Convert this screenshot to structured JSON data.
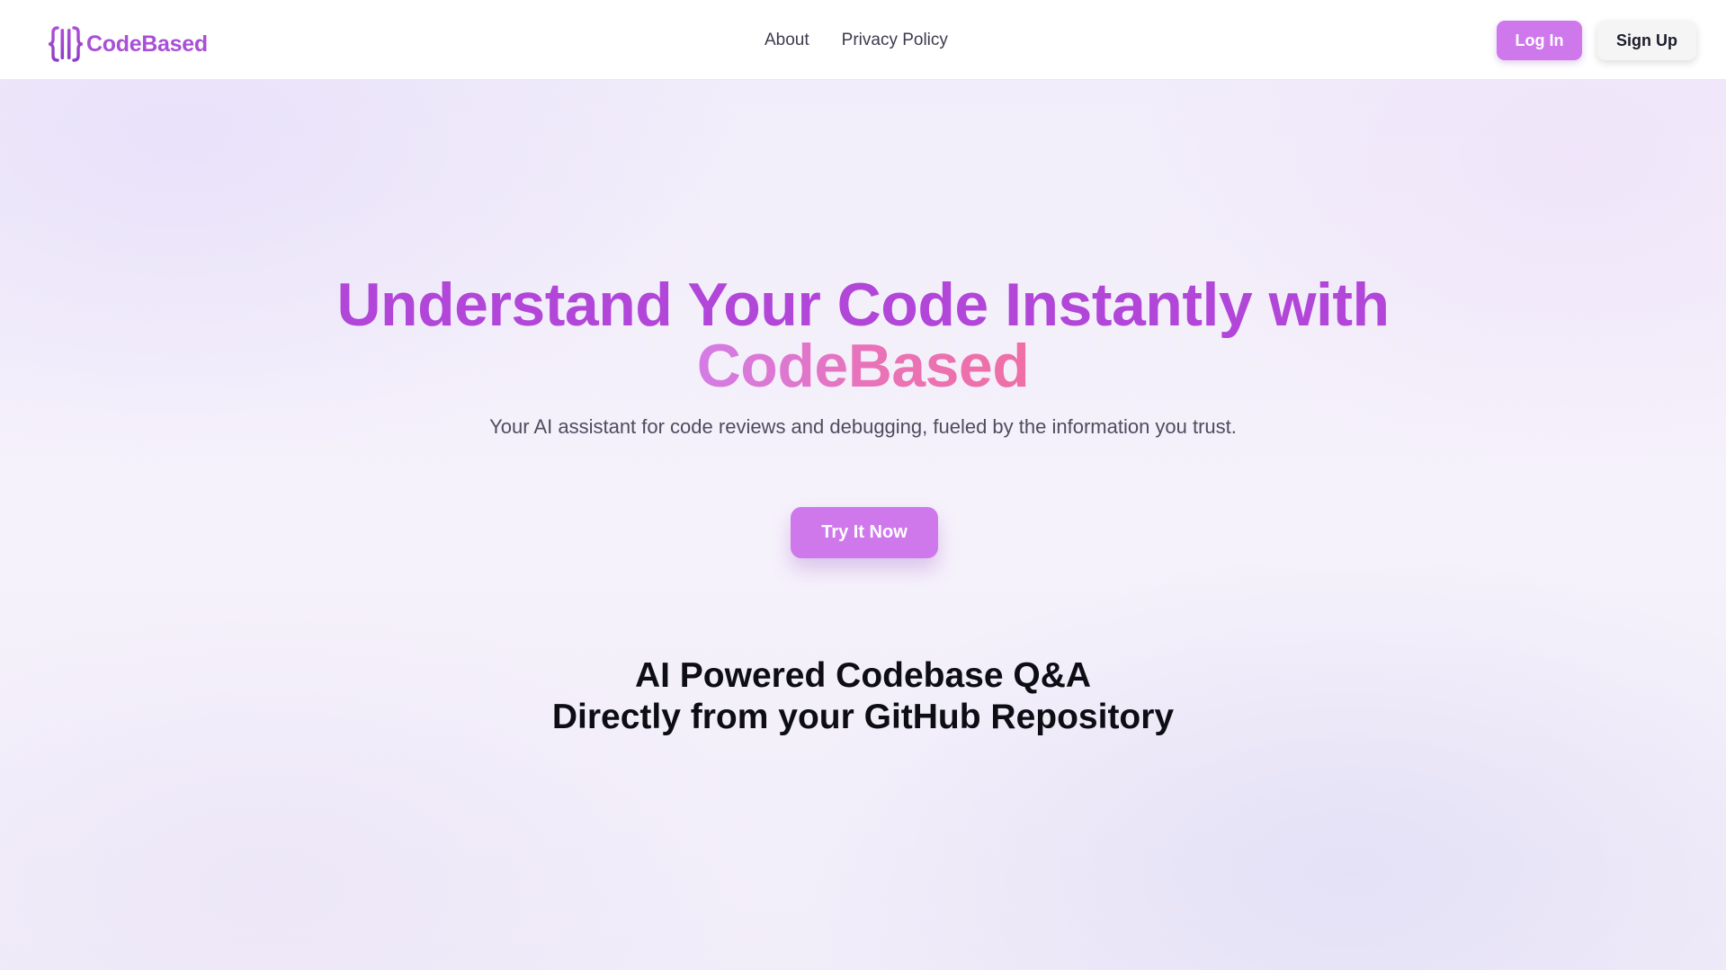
{
  "brand": {
    "name": "CodeBased",
    "icon": "curly-brace-brackets-logo-icon",
    "accent_color": "#a850d6"
  },
  "nav": {
    "links": [
      {
        "label": "About"
      },
      {
        "label": "Privacy Policy"
      }
    ],
    "login_label": "Log In",
    "signup_label": "Sign Up"
  },
  "hero": {
    "headline_line1": "Understand Your Code Instantly with",
    "headline_line2": "CodeBased",
    "subtitle": "Your AI assistant for code reviews and debugging, fueled by the information you trust.",
    "cta_label": "Try It Now"
  },
  "section": {
    "title_line1": "AI Powered Codebase Q&A",
    "title_line2": "Directly from your GitHub Repository"
  },
  "colors": {
    "primary_button": "#cf78ec",
    "headline_purple": "#b146d9",
    "headline_gradient_start": "#d37ce6",
    "headline_gradient_end": "#ef6fa6"
  }
}
